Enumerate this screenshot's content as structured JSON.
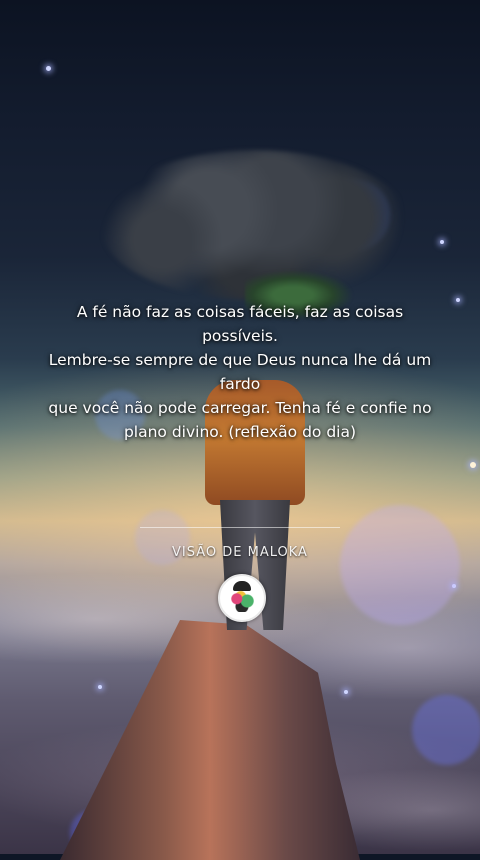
{
  "quote": {
    "lines": [
      "A fé não faz as coisas fáceis, faz as coisas possíveis.",
      "Lembre-se sempre de que Deus nunca lhe dá um fardo",
      "que você não pode carregar. Tenha fé e confie no",
      "plano divino. (reflexão do dia)"
    ]
  },
  "brand": {
    "name": "VISÃO DE MALOKA"
  },
  "colors": {
    "text": "#ffffff",
    "sky_top": "#0c1322",
    "horizon": "#c9b58e"
  }
}
